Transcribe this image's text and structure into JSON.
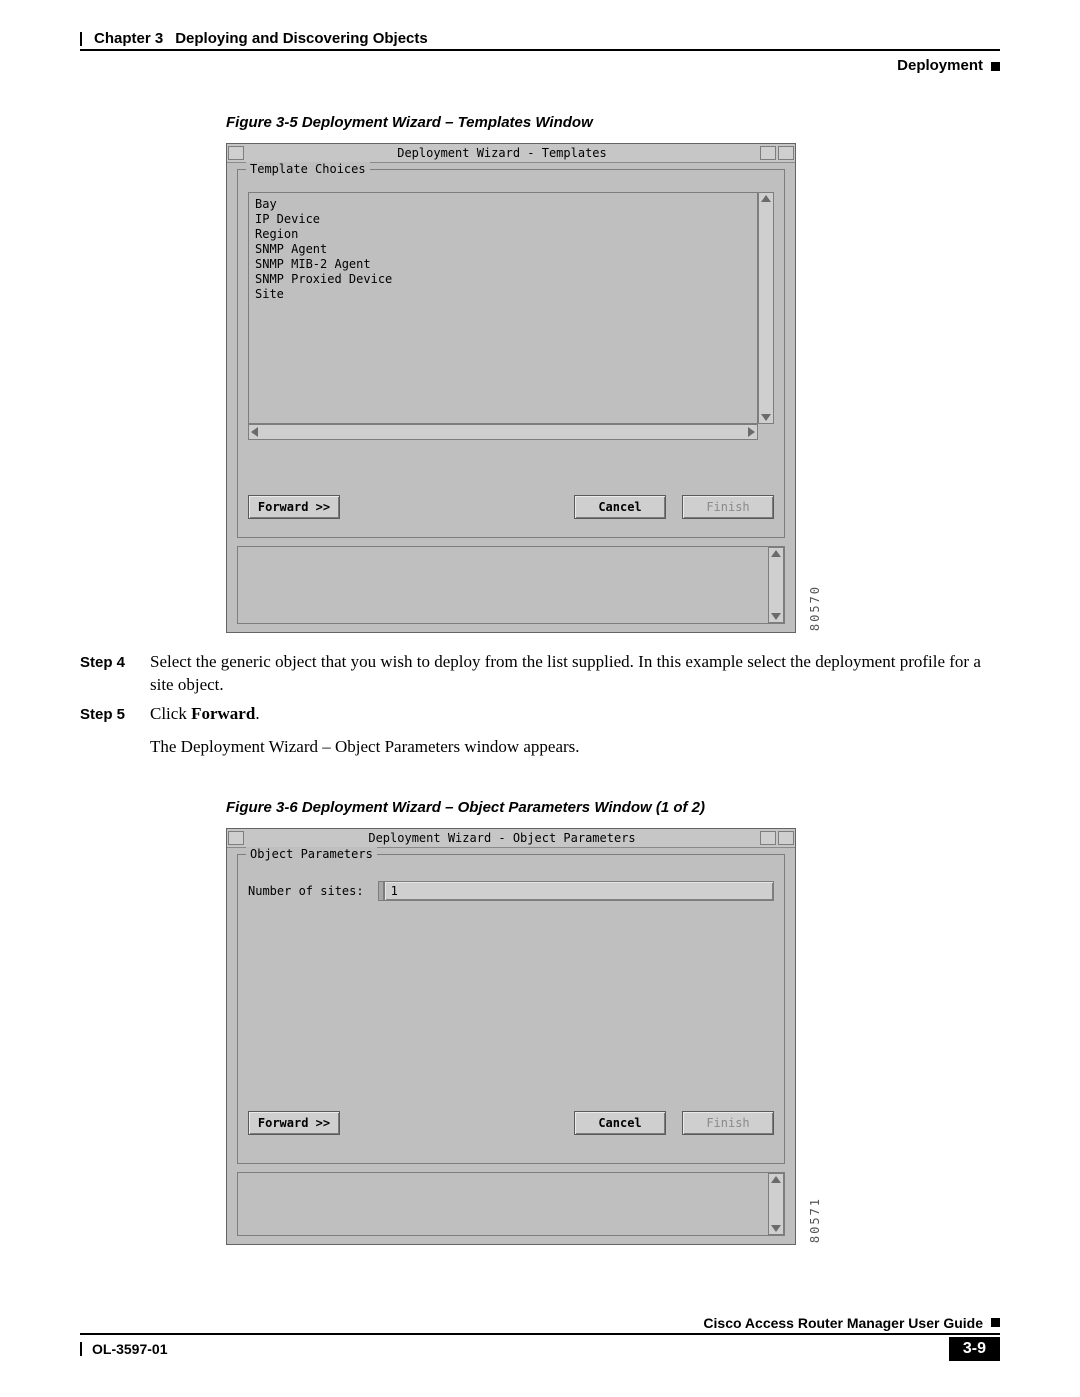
{
  "header": {
    "chapter": "Chapter 3",
    "chapter_title": "Deploying and Discovering Objects",
    "section": "Deployment"
  },
  "figure1": {
    "caption": "Figure 3-5    Deployment Wizard – Templates Window",
    "window_title": "Deployment Wizard - Templates",
    "group_label": "Template Choices",
    "items": [
      "Bay",
      "IP Device",
      "Region",
      "SNMP Agent",
      "SNMP MIB-2 Agent",
      "SNMP Proxied Device",
      "Site"
    ],
    "buttons": {
      "forward": "Forward >>",
      "cancel": "Cancel",
      "finish": "Finish"
    },
    "image_number": "80570"
  },
  "steps": {
    "s4_label": "Step 4",
    "s4_body": "Select the generic object that you wish to deploy from the list supplied. In this example select the deployment profile for a site object.",
    "s5_label": "Step 5",
    "s5_body_pre": "Click ",
    "s5_body_bold": "Forward",
    "s5_body_post": ".",
    "s5_sub": "The Deployment Wizard – Object Parameters window appears."
  },
  "figure2": {
    "caption": "Figure 3-6    Deployment Wizard – Object Parameters Window (1 of 2)",
    "window_title": "Deployment Wizard - Object Parameters",
    "group_label": "Object Parameters",
    "param_label": "Number of sites:",
    "param_value": "1",
    "buttons": {
      "forward": "Forward >>",
      "cancel": "Cancel",
      "finish": "Finish"
    },
    "image_number": "80571"
  },
  "footer": {
    "doc_title": "Cisco Access Router Manager User Guide",
    "doc_num": "OL-3597-01",
    "page_num": "3-9"
  }
}
